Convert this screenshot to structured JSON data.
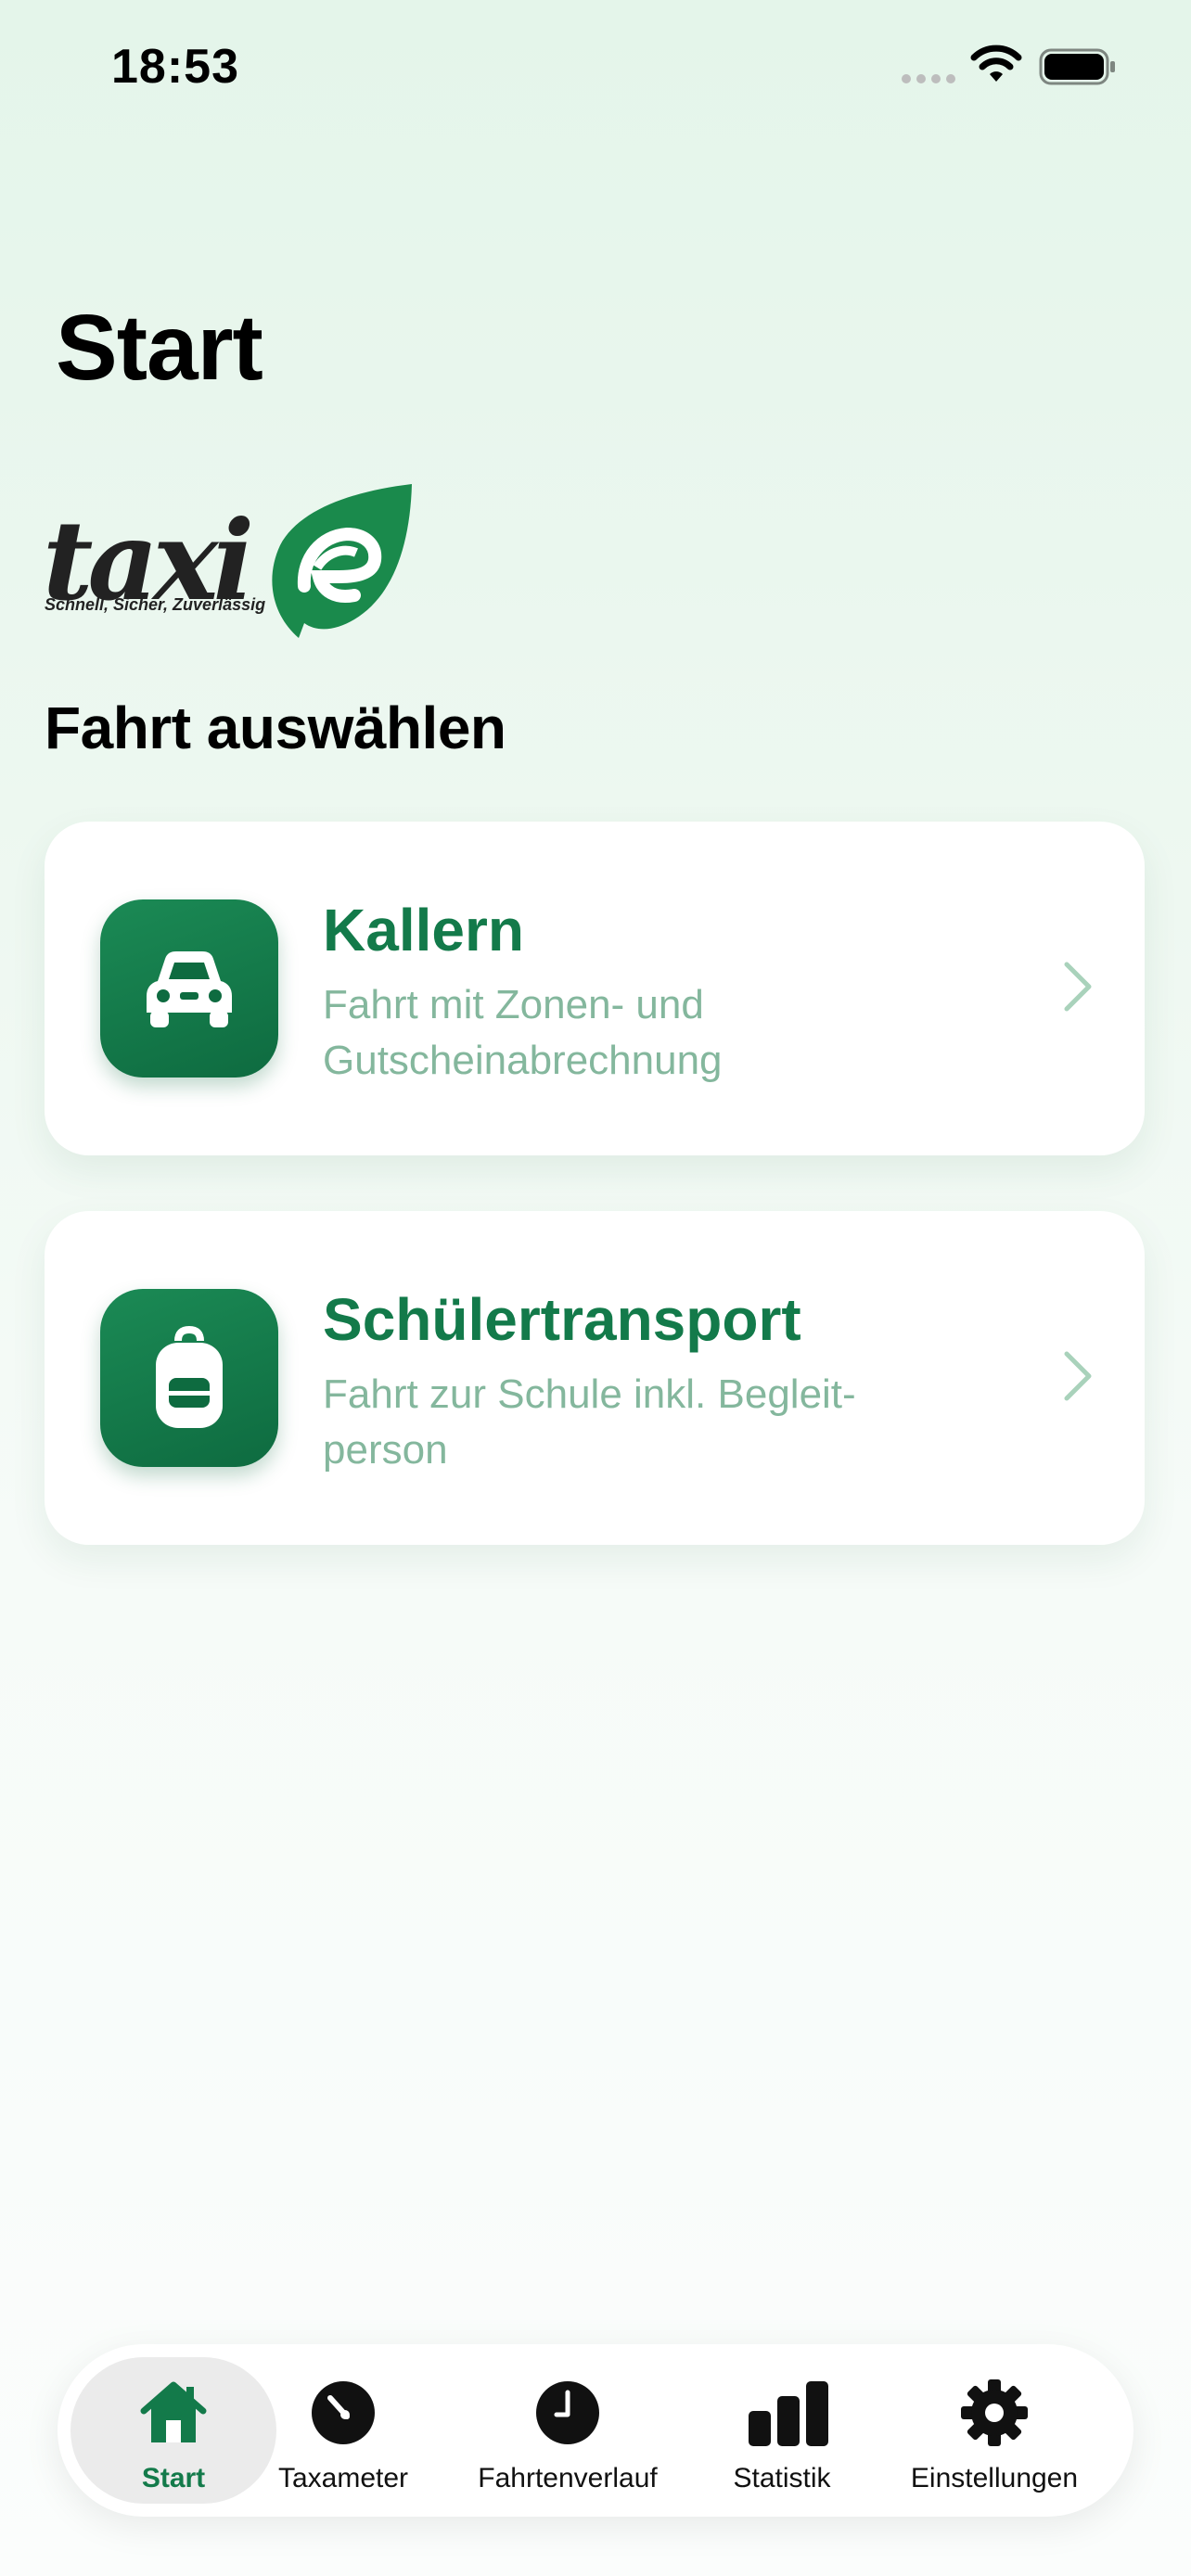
{
  "status_bar": {
    "time": "18:53"
  },
  "page": {
    "title": "Start"
  },
  "logo": {
    "wordmark": "taxie",
    "tagline": "Schnell, Sicher, Zuverlässig"
  },
  "section": {
    "heading": "Fahrt auswählen"
  },
  "cards": [
    {
      "title": "Kallern",
      "subtitle": "Fahrt mit Zonen- und Gutscheinabrechnung",
      "icon": "car-icon"
    },
    {
      "title": "Schülertransport",
      "subtitle": "Fahrt zur Schule inkl. Begleit-person",
      "icon": "backpack-icon"
    }
  ],
  "tab_bar": {
    "active": "Start",
    "items": [
      {
        "label": "Start",
        "icon": "house-icon"
      },
      {
        "label": "Taxameter",
        "icon": "gauge-icon"
      },
      {
        "label": "Fahrtenverlauf",
        "icon": "clock-icon"
      },
      {
        "label": "Statistik",
        "icon": "bar-chart-icon"
      },
      {
        "label": "Einstellungen",
        "icon": "gear-icon"
      }
    ]
  },
  "colors": {
    "accent": "#137a4a",
    "icon_bg": "#0e6b40",
    "subtitle": "#84b79d",
    "background": "#e4f5ea"
  }
}
